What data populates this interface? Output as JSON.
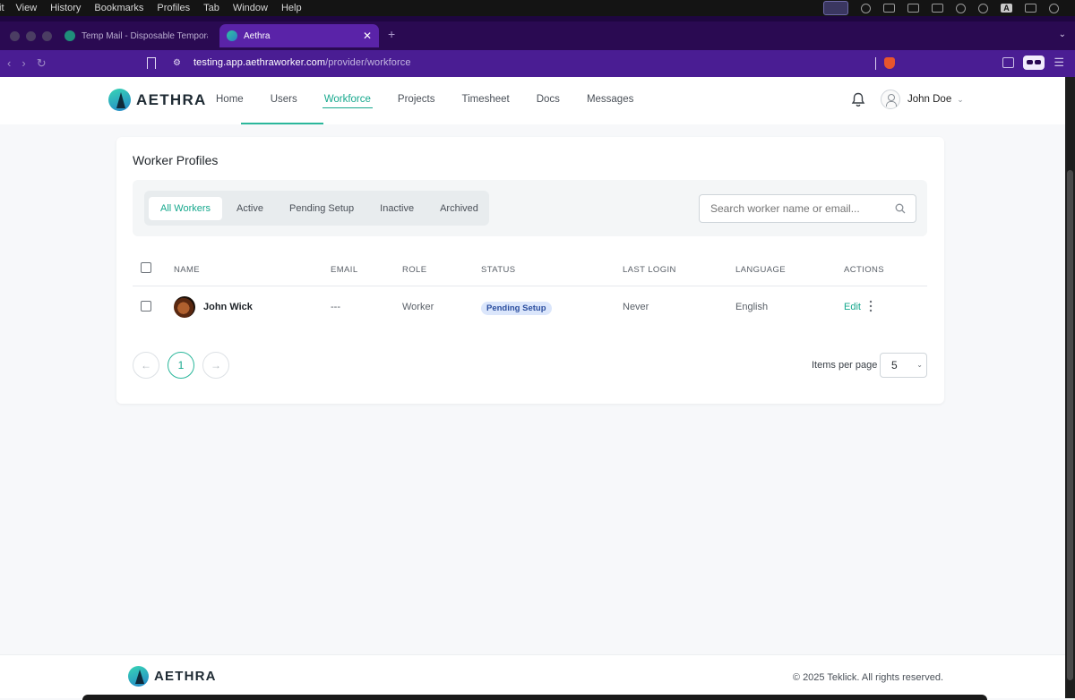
{
  "os_menu": [
    "it",
    "View",
    "History",
    "Bookmarks",
    "Profiles",
    "Tab",
    "Window",
    "Help"
  ],
  "browser": {
    "tabs": [
      {
        "title": "Temp Mail - Disposable Temporar",
        "active": false
      },
      {
        "title": "Aethra",
        "active": true
      }
    ],
    "close_glyph": "✕",
    "new_tab_glyph": "+",
    "url_host": "testing.app.aethraworker.com",
    "url_path": "/provider/workforce"
  },
  "header": {
    "brand": "AETHRA",
    "nav": [
      "Home",
      "Users",
      "Workforce",
      "Projects",
      "Timesheet",
      "Docs",
      "Messages"
    ],
    "active_nav": "Workforce",
    "user_name": "John Doe"
  },
  "page": {
    "title": "Worker Profiles",
    "filters": [
      "All Workers",
      "Active",
      "Pending Setup",
      "Inactive",
      "Archived"
    ],
    "active_filter": "All Workers",
    "search_placeholder": "Search worker name or email...",
    "columns": [
      "NAME",
      "EMAIL",
      "ROLE",
      "STATUS",
      "LAST LOGIN",
      "LANGUAGE",
      "ACTIONS"
    ],
    "rows": [
      {
        "name": "John Wick",
        "email": "---",
        "role": "Worker",
        "status": "Pending Setup",
        "last_login": "Never",
        "language": "English",
        "action": "Edit"
      }
    ],
    "pagination": {
      "prev": "←",
      "current": "1",
      "next": "→"
    },
    "items_per_page_label": "Items per page",
    "items_per_page": "5"
  },
  "footer": {
    "brand": "AETHRA",
    "copyright": "© 2025 Teklick. All rights reserved."
  },
  "colors": {
    "accent": "#16a88d",
    "browser_bg": "#4a1d93",
    "badge_bg": "#dbe6fb"
  }
}
